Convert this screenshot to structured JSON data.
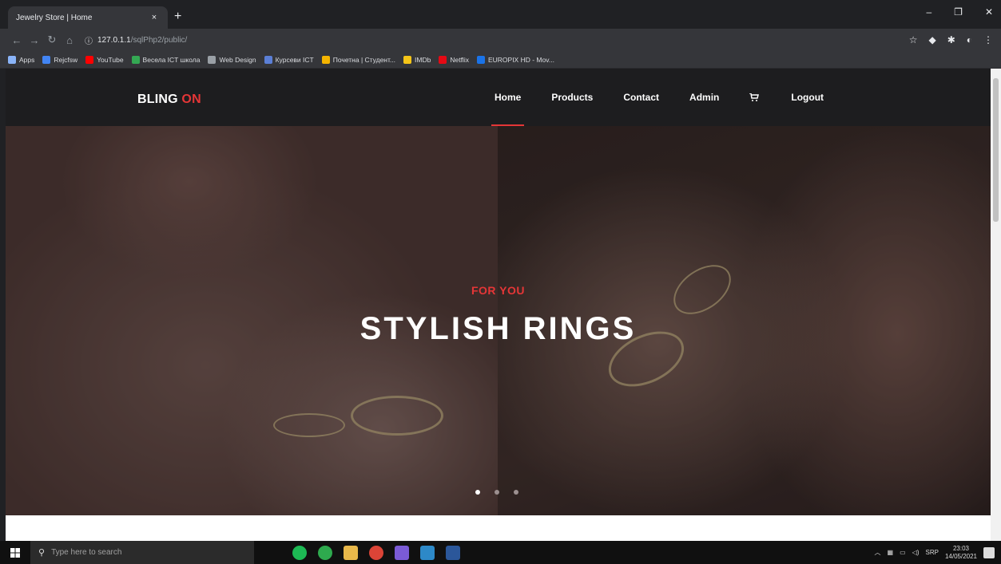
{
  "browser": {
    "tab_title": "Jewelry Store | Home",
    "tab_close": "×",
    "new_tab": "+",
    "window_controls": [
      "–",
      "❐",
      "✕"
    ],
    "url_host": "127.0.1.1",
    "url_path": "/sqlPhp2/public/",
    "bookmarks": [
      {
        "label": "Apps",
        "color": "#8ab4f8"
      },
      {
        "label": "Rejcfsw",
        "color": "#4285f4"
      },
      {
        "label": "YouTube",
        "color": "#ff0000"
      },
      {
        "label": "Весела ICT школа",
        "color": "#34a853"
      },
      {
        "label": "Web Design",
        "color": "#9aa0a6"
      },
      {
        "label": "Курсеви ICT",
        "color": "#5b7fd6"
      },
      {
        "label": "Почетна | Студент...",
        "color": "#f4b400"
      },
      {
        "label": "IMDb",
        "color": "#f5c518"
      },
      {
        "label": "Netflix",
        "color": "#e50914"
      },
      {
        "label": "EUROPIX HD - Mov...",
        "color": "#1a73e8"
      }
    ]
  },
  "site": {
    "brand_main": "BLING ",
    "brand_accent": "ON",
    "accent_color": "#e53637",
    "menu": [
      {
        "label": "Home",
        "active": true
      },
      {
        "label": "Products",
        "active": false
      },
      {
        "label": "Contact",
        "active": false
      },
      {
        "label": "Admin",
        "active": false
      }
    ],
    "logout_label": "Logout"
  },
  "hero": {
    "subtitle": "FOR YOU",
    "title": "STYLISH RINGS",
    "slide_count": 3,
    "active_slide": 1
  },
  "taskbar": {
    "search_placeholder": "Type here to search",
    "tray_lang": "SRP",
    "time": "23:03",
    "date": "14/05/2021",
    "app_colors": [
      "#1db954",
      "#2eaa4e",
      "#e8b84a",
      "#db4437",
      "#7b5bd6",
      "#2d89c8",
      "#2b579a"
    ]
  }
}
